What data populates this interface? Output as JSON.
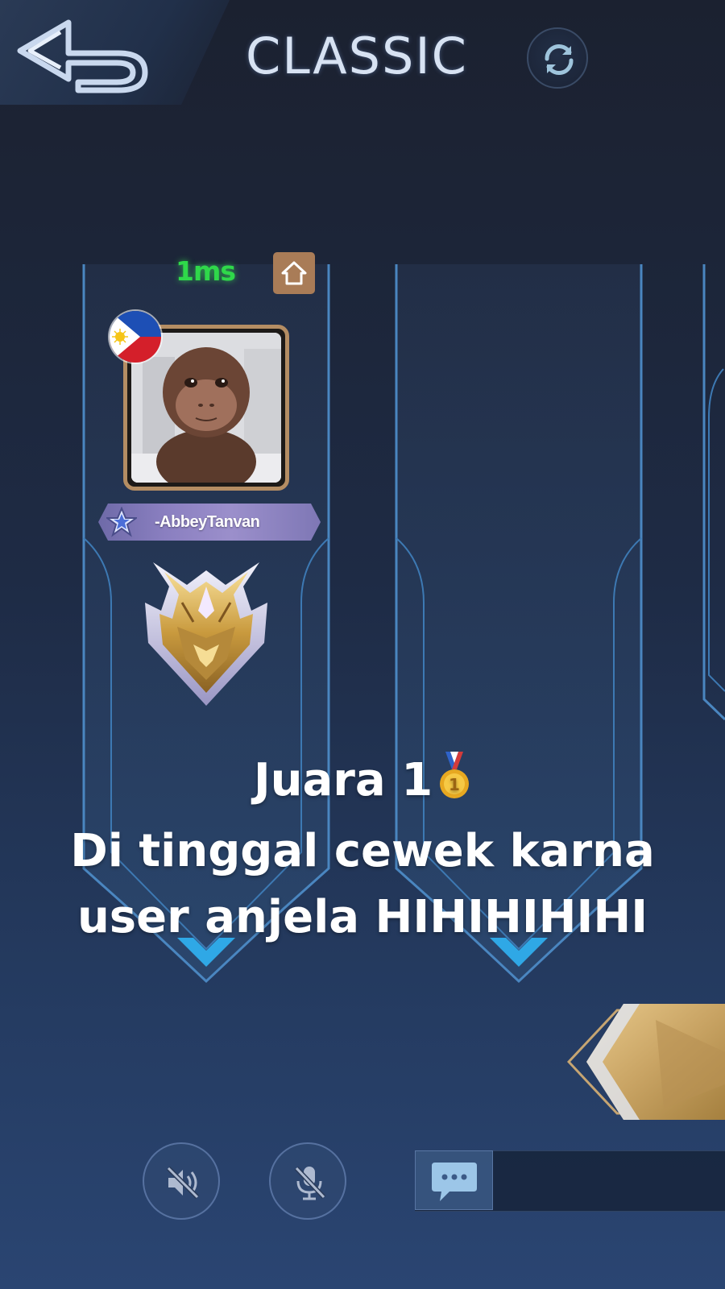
{
  "header": {
    "title": "CLASSIC",
    "back_icon": "back-arrow-icon",
    "refresh_icon": "refresh-icon"
  },
  "player_slot": {
    "ping": "1ms",
    "ping_color": "#2fd84a",
    "home_icon": "home-icon",
    "flag_icon": "philippines-flag-icon",
    "player_name": "-AbbeyTanvan",
    "rank_icon": "mythic-rank-emblem-icon"
  },
  "caption": {
    "line1": "Juara 1",
    "line1_icon": "gold-medal-icon",
    "line2": "Di tinggal cewek karna",
    "line3": "user anjela HIHIHIHIHI"
  },
  "bottom_bar": {
    "speaker_icon": "speaker-muted-icon",
    "mic_icon": "microphone-muted-icon",
    "chat_icon": "chat-bubble-icon"
  },
  "colors": {
    "accent_blue": "#2fa8e6",
    "frame_gold": "#b48d63",
    "name_plate": "#8a7fc0"
  }
}
